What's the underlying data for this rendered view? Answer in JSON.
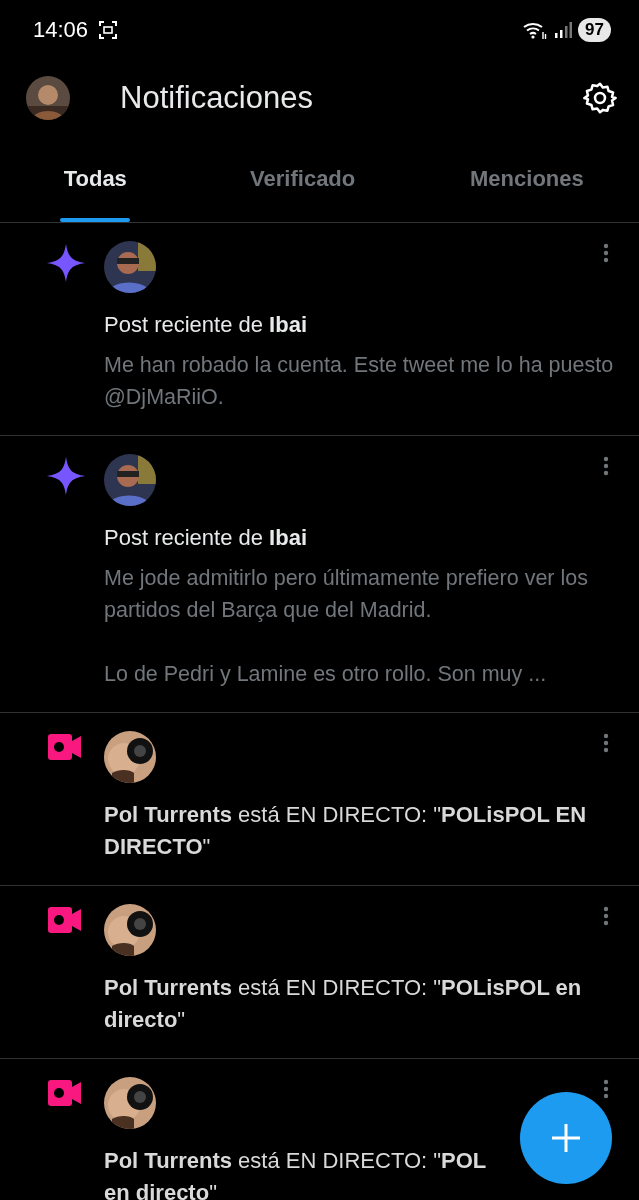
{
  "status_bar": {
    "time": "14:06",
    "battery": "97"
  },
  "header": {
    "title": "Notificaciones"
  },
  "tabs": [
    {
      "label": "Todas",
      "selected": true
    },
    {
      "label": "Verificado",
      "selected": false
    },
    {
      "label": "Menciones",
      "selected": false
    }
  ],
  "notifications": [
    {
      "kind": "post",
      "title": "Post reciente de **Ibai**",
      "body": "Me han robado la cuenta. Este tweet me lo ha puesto @DjMaRiiO."
    },
    {
      "kind": "post",
      "title": "Post reciente de **Ibai**",
      "body": "Me jode admitirlo pero últimamente prefiero ver los partidos del Barça que del Madrid.\n\nLo de Pedri y Lamine es otro rollo. Son muy ..."
    },
    {
      "kind": "live",
      "title": "**Pol Turrents** está EN DIRECTO: \"**POLisPOL EN DIRECTO**\""
    },
    {
      "kind": "live",
      "title": "**Pol Turrents** está EN DIRECTO: \"**POLisPOL en directo**\""
    },
    {
      "kind": "live",
      "title": "**Pol Turrents** está EN DIRECTO: \"**POL**\n**en directo**\""
    }
  ]
}
